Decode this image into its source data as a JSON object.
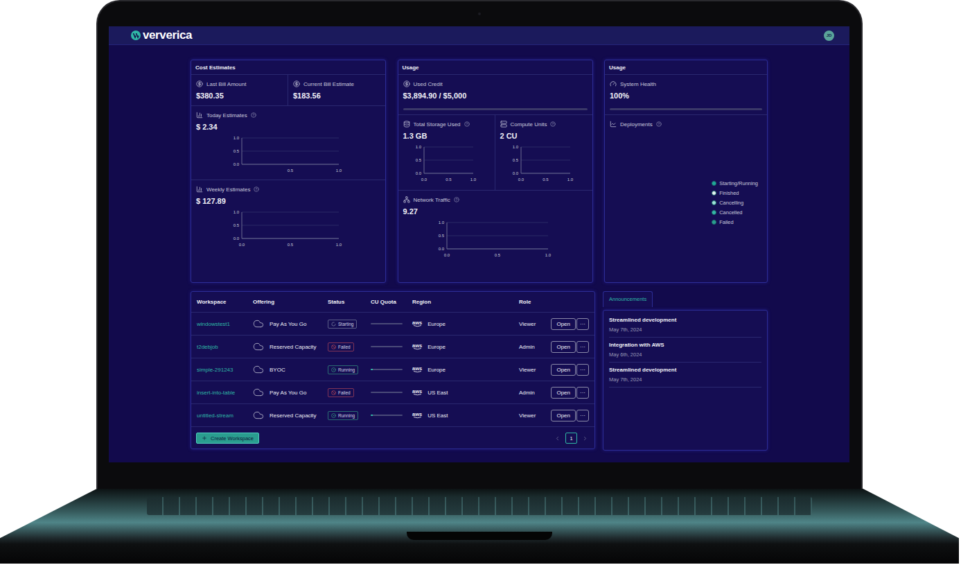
{
  "header": {
    "logo": "ververica",
    "avatar": "JD"
  },
  "cost_card": {
    "title": "Cost Estimates",
    "bills": [
      {
        "label": "Last Bill Amount",
        "value": "$380.35"
      },
      {
        "label": "Current Bill Estimate",
        "value": "$183.56"
      }
    ],
    "estimates": [
      {
        "label": "Today Estimates",
        "value": "$ 2.34",
        "chart": {
          "y_ticks": [
            "1.0",
            "0.5",
            "0.0"
          ],
          "x_ticks": [
            "0.5",
            "1.0"
          ],
          "series": []
        }
      },
      {
        "label": "Weekly Estimates",
        "value": "$ 127.89",
        "chart": {
          "y_ticks": [
            "1.0",
            "0.5",
            "0.0"
          ],
          "x_ticks": [
            "0.0",
            "0.5",
            "1.0"
          ],
          "series": []
        }
      }
    ]
  },
  "usage_card": {
    "title": "Usage",
    "credit": {
      "label": "Used Credit",
      "value": "$3,894.90 / $5,000",
      "level": 0
    },
    "metrics": [
      {
        "label": "Total Storage Used",
        "value": "1.3 GB",
        "chart": {
          "y_ticks": [
            "1.0",
            "0.5",
            "0.0"
          ],
          "x_ticks": [
            "0.0",
            "0.5",
            "1.0"
          ],
          "series": []
        }
      },
      {
        "label": "Compute Units",
        "value": "2 CU",
        "chart": {
          "y_ticks": [
            "1.0",
            "0.5",
            "0.0"
          ],
          "x_ticks": [
            "0.0",
            "0.5",
            "1.0"
          ],
          "series": []
        }
      }
    ],
    "network": {
      "label": "Network Traffic",
      "value": "9.27",
      "chart": {
        "y_ticks": [
          "1.0",
          "0.5",
          "0.0"
        ],
        "x_ticks": [
          "0.0",
          "0.5",
          "1.0"
        ],
        "series": []
      }
    }
  },
  "health_card": {
    "title": "Usage",
    "health": {
      "label": "System Health",
      "value": "100%",
      "level": 0
    },
    "deployments": {
      "label": "Deployments",
      "legend": [
        {
          "label": "Starting/Running",
          "color": "#1fa89a"
        },
        {
          "label": "Finished",
          "color": "#e6f4f2"
        },
        {
          "label": "Cancelling",
          "color": "#9fe3da"
        },
        {
          "label": "Cancelled",
          "color": "#35b7a8"
        },
        {
          "label": "Failed",
          "color": "#2a9e91"
        }
      ]
    }
  },
  "table": {
    "columns": [
      "Workspace",
      "Offering",
      "Status",
      "CU Quota",
      "Region",
      "Role"
    ],
    "open_label": "Open",
    "more_label": "···",
    "rows": [
      {
        "workspace": "windowstest1",
        "offering": "Pay As You Go",
        "status": "Starting",
        "kind": "starting",
        "color": "#9aa3b8",
        "quota_level": 0,
        "provider": "aws",
        "region": "Europe",
        "role": "Viewer"
      },
      {
        "workspace": "t2debjob",
        "offering": "Reserved Capacity",
        "status": "Failed",
        "kind": "failed",
        "color": "#e0565b",
        "quota_level": 0,
        "provider": "aws",
        "region": "Europe",
        "role": "Admin"
      },
      {
        "workspace": "simple-291243",
        "offering": "BYOC",
        "status": "Running",
        "kind": "running",
        "color": "#3fbf8f",
        "quota_level": 0.06,
        "provider": "aws",
        "region": "Europe",
        "role": "Viewer"
      },
      {
        "workspace": "insert-into-table",
        "offering": "Pay As You Go",
        "status": "Failed",
        "kind": "failed",
        "color": "#e0565b",
        "quota_level": 0,
        "provider": "aws",
        "region": "US East",
        "role": "Admin"
      },
      {
        "workspace": "untitled-stream",
        "offering": "Reserved Capacity",
        "status": "Running",
        "kind": "running",
        "color": "#3fbf8f",
        "quota_level": 0.06,
        "provider": "aws",
        "region": "US East",
        "role": "Viewer"
      }
    ]
  },
  "create_button": {
    "label": "Create Workspace"
  },
  "pagination": {
    "pages": [
      {
        "label": "1",
        "selected": true
      }
    ]
  },
  "announcements": {
    "tabs": [
      {
        "label": "Announcements",
        "selected": true
      }
    ],
    "items": [
      {
        "title": "Streamlined development",
        "date": "May 7th, 2024"
      },
      {
        "title": "Integration with AWS",
        "date": "May 6th, 2024"
      },
      {
        "title": "Streamlined development",
        "date": "May 7th, 2024"
      }
    ]
  }
}
